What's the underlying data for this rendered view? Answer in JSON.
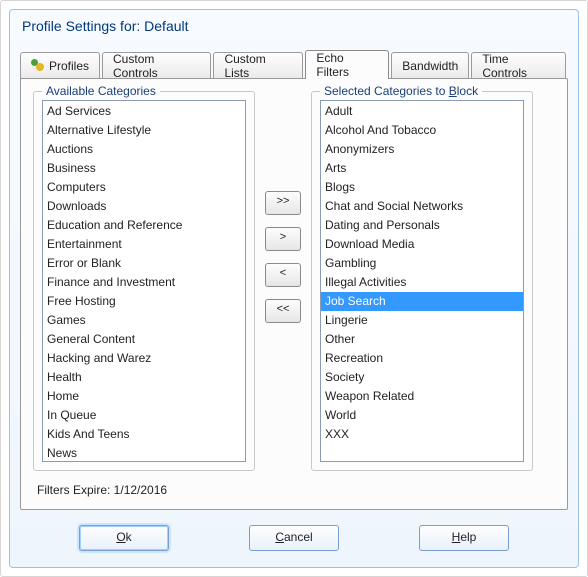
{
  "title": "Profile Settings for: Default",
  "tabs": [
    {
      "label": "Profiles",
      "active": false,
      "hasIcon": true
    },
    {
      "label": "Custom Controls",
      "active": false,
      "hasIcon": false
    },
    {
      "label": "Custom Lists",
      "active": false,
      "hasIcon": false
    },
    {
      "label": "Echo Filters",
      "active": true,
      "hasIcon": false
    },
    {
      "label": "Bandwidth",
      "active": false,
      "hasIcon": false
    },
    {
      "label": "Time Controls",
      "active": false,
      "hasIcon": false
    }
  ],
  "availableLegend": "Available Categories",
  "available": [
    "Ad Services",
    "Alternative Lifestyle",
    "Auctions",
    "Business",
    "Computers",
    "Downloads",
    "Education and Reference",
    "Entertainment",
    "Error or Blank",
    "Finance and Investment",
    "Free Hosting",
    "Games",
    "General Content",
    "Hacking and Warez",
    "Health",
    "Home",
    "In Queue",
    "Kids And Teens",
    "News"
  ],
  "selectedLegendPrefix": "Selected Categories to ",
  "selectedLegendUnderlined": "B",
  "selectedLegendSuffix": "lock",
  "selected": [
    {
      "label": "Adult",
      "sel": false
    },
    {
      "label": "Alcohol And Tobacco",
      "sel": false
    },
    {
      "label": "Anonymizers",
      "sel": false
    },
    {
      "label": "Arts",
      "sel": false
    },
    {
      "label": "Blogs",
      "sel": false
    },
    {
      "label": "Chat and Social Networks",
      "sel": false
    },
    {
      "label": "Dating and Personals",
      "sel": false
    },
    {
      "label": "Download Media",
      "sel": false
    },
    {
      "label": "Gambling",
      "sel": false
    },
    {
      "label": "Illegal Activities",
      "sel": false
    },
    {
      "label": "Job Search",
      "sel": true
    },
    {
      "label": "Lingerie",
      "sel": false
    },
    {
      "label": "Other",
      "sel": false
    },
    {
      "label": "Recreation",
      "sel": false
    },
    {
      "label": "Society",
      "sel": false
    },
    {
      "label": "Weapon Related",
      "sel": false
    },
    {
      "label": "World",
      "sel": false
    },
    {
      "label": "XXX",
      "sel": false
    }
  ],
  "moveButtons": {
    "allRight": ">>",
    "right": ">",
    "left": "<",
    "allLeft": "<<"
  },
  "expire": "Filters Expire: 1/12/2016",
  "buttons": {
    "ok": {
      "u": "O",
      "rest": "k"
    },
    "cancel": {
      "u": "C",
      "rest": "ancel"
    },
    "help": {
      "u": "H",
      "rest": "elp"
    }
  }
}
